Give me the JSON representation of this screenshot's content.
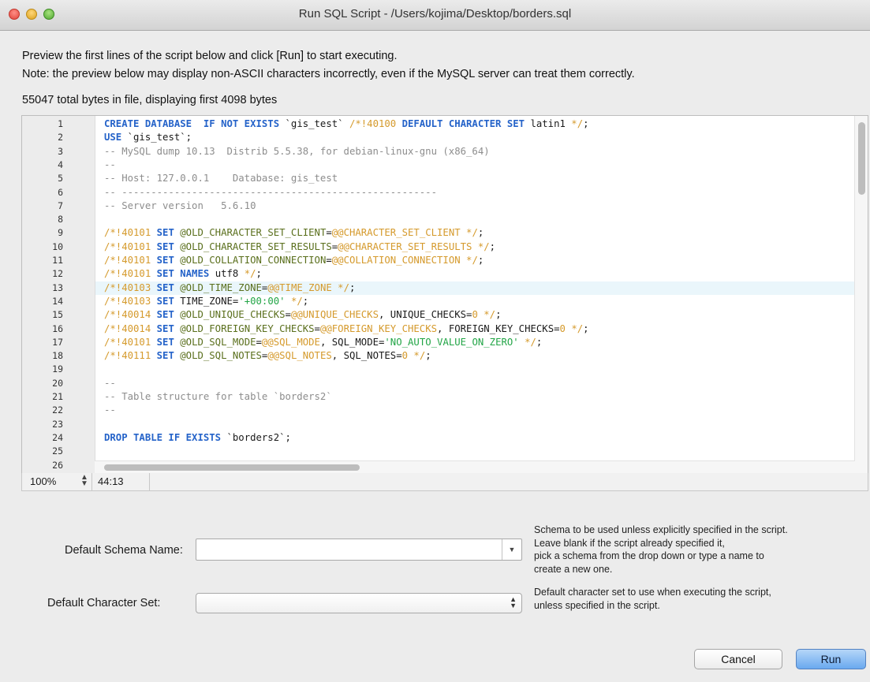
{
  "window": {
    "title": "Run SQL Script - /Users/kojima/Desktop/borders.sql"
  },
  "notes": {
    "line1": "Preview the first lines of the script below and click [Run] to start executing.",
    "line2": "Note: the preview below may display non-ASCII characters incorrectly, even if the MySQL server can treat them correctly.",
    "bytes": "55047 total bytes in file, displaying first 4098 bytes"
  },
  "editor": {
    "highlighted_line": 13,
    "lines": [
      [
        [
          "kw",
          "CREATE DATABASE  IF NOT EXISTS "
        ],
        [
          "",
          "`gis_test` "
        ],
        [
          "ex",
          "/*!40100 "
        ],
        [
          "kw",
          "DEFAULT CHARACTER SET "
        ],
        [
          "",
          "latin1 "
        ],
        [
          "ex",
          "*/"
        ],
        [
          "",
          ";"
        ]
      ],
      [
        [
          "kw",
          "USE "
        ],
        [
          "",
          "`gis_test`;"
        ]
      ],
      [
        [
          "cm",
          "-- MySQL dump 10.13  Distrib 5.5.38, for debian-linux-gnu (x86_64)"
        ]
      ],
      [
        [
          "cm",
          "--"
        ]
      ],
      [
        [
          "cm",
          "-- Host: 127.0.0.1    Database: gis_test"
        ]
      ],
      [
        [
          "cm",
          "-- ------------------------------------------------------"
        ]
      ],
      [
        [
          "cm",
          "-- Server version   5.6.10"
        ]
      ],
      [],
      [
        [
          "ex",
          "/*!40101 "
        ],
        [
          "kw",
          "SET "
        ],
        [
          "vr",
          "@OLD_CHARACTER_SET_CLIENT"
        ],
        [
          "",
          "="
        ],
        [
          "vc",
          "@@CHARACTER_SET_CLIENT "
        ],
        [
          "ex",
          "*/"
        ],
        [
          "",
          ";"
        ]
      ],
      [
        [
          "ex",
          "/*!40101 "
        ],
        [
          "kw",
          "SET "
        ],
        [
          "vr",
          "@OLD_CHARACTER_SET_RESULTS"
        ],
        [
          "",
          "="
        ],
        [
          "vc",
          "@@CHARACTER_SET_RESULTS "
        ],
        [
          "ex",
          "*/"
        ],
        [
          "",
          ";"
        ]
      ],
      [
        [
          "ex",
          "/*!40101 "
        ],
        [
          "kw",
          "SET "
        ],
        [
          "vr",
          "@OLD_COLLATION_CONNECTION"
        ],
        [
          "",
          "="
        ],
        [
          "vc",
          "@@COLLATION_CONNECTION "
        ],
        [
          "ex",
          "*/"
        ],
        [
          "",
          ";"
        ]
      ],
      [
        [
          "ex",
          "/*!40101 "
        ],
        [
          "kw",
          "SET NAMES "
        ],
        [
          "",
          "utf8 "
        ],
        [
          "ex",
          "*/"
        ],
        [
          "",
          ";"
        ]
      ],
      [
        [
          "ex",
          "/*!40103 "
        ],
        [
          "kw",
          "SET "
        ],
        [
          "vr",
          "@OLD_TIME_ZONE"
        ],
        [
          "",
          "="
        ],
        [
          "vc",
          "@@TIME_ZONE "
        ],
        [
          "ex",
          "*/"
        ],
        [
          "",
          ";"
        ]
      ],
      [
        [
          "ex",
          "/*!40103 "
        ],
        [
          "kw",
          "SET "
        ],
        [
          "",
          "TIME_ZONE="
        ],
        [
          "st",
          "'+00:00' "
        ],
        [
          "ex",
          "*/"
        ],
        [
          "",
          ";"
        ]
      ],
      [
        [
          "ex",
          "/*!40014 "
        ],
        [
          "kw",
          "SET "
        ],
        [
          "vr",
          "@OLD_UNIQUE_CHECKS"
        ],
        [
          "",
          "="
        ],
        [
          "vc",
          "@@UNIQUE_CHECKS"
        ],
        [
          "",
          ", UNIQUE_CHECKS="
        ],
        [
          "vc",
          "0 "
        ],
        [
          "ex",
          "*/"
        ],
        [
          "",
          ";"
        ]
      ],
      [
        [
          "ex",
          "/*!40014 "
        ],
        [
          "kw",
          "SET "
        ],
        [
          "vr",
          "@OLD_FOREIGN_KEY_CHECKS"
        ],
        [
          "",
          "="
        ],
        [
          "vc",
          "@@FOREIGN_KEY_CHECKS"
        ],
        [
          "",
          ", FOREIGN_KEY_CHECKS="
        ],
        [
          "vc",
          "0 "
        ],
        [
          "ex",
          "*/"
        ],
        [
          "",
          ";"
        ]
      ],
      [
        [
          "ex",
          "/*!40101 "
        ],
        [
          "kw",
          "SET "
        ],
        [
          "vr",
          "@OLD_SQL_MODE"
        ],
        [
          "",
          "="
        ],
        [
          "vc",
          "@@SQL_MODE"
        ],
        [
          "",
          ", SQL_MODE="
        ],
        [
          "st",
          "'NO_AUTO_VALUE_ON_ZERO' "
        ],
        [
          "ex",
          "*/"
        ],
        [
          "",
          ";"
        ]
      ],
      [
        [
          "ex",
          "/*!40111 "
        ],
        [
          "kw",
          "SET "
        ],
        [
          "vr",
          "@OLD_SQL_NOTES"
        ],
        [
          "",
          "="
        ],
        [
          "vc",
          "@@SQL_NOTES"
        ],
        [
          "",
          ", SQL_NOTES="
        ],
        [
          "vc",
          "0 "
        ],
        [
          "ex",
          "*/"
        ],
        [
          "",
          ";"
        ]
      ],
      [],
      [
        [
          "cm",
          "--"
        ]
      ],
      [
        [
          "cm",
          "-- Table structure for table `borders2`"
        ]
      ],
      [
        [
          "cm",
          "--"
        ]
      ],
      [],
      [
        [
          "kw",
          "DROP TABLE IF EXISTS "
        ],
        [
          "",
          "`borders2`;"
        ]
      ],
      [],
      []
    ]
  },
  "status": {
    "zoom": "100%",
    "position": "44:13"
  },
  "form": {
    "schema_label": "Default Schema Name:",
    "schema_value": "",
    "schema_help": [
      "Schema to be used unless explicitly specified in the script.",
      "Leave blank if the script already specified it,",
      "pick a schema from the drop down or type a name to",
      "create a new one."
    ],
    "charset_label": "Default Character Set:",
    "charset_value": "",
    "charset_help": [
      "Default character set to use when executing the script,",
      "unless specified in the script."
    ]
  },
  "buttons": {
    "cancel": "Cancel",
    "run": "Run"
  },
  "colors": {
    "keyword": "#2563c9",
    "comment": "#8d8d8d",
    "string": "#22a546",
    "sysvar": "#d59a2c",
    "primary_button": "#6aa9ef"
  }
}
